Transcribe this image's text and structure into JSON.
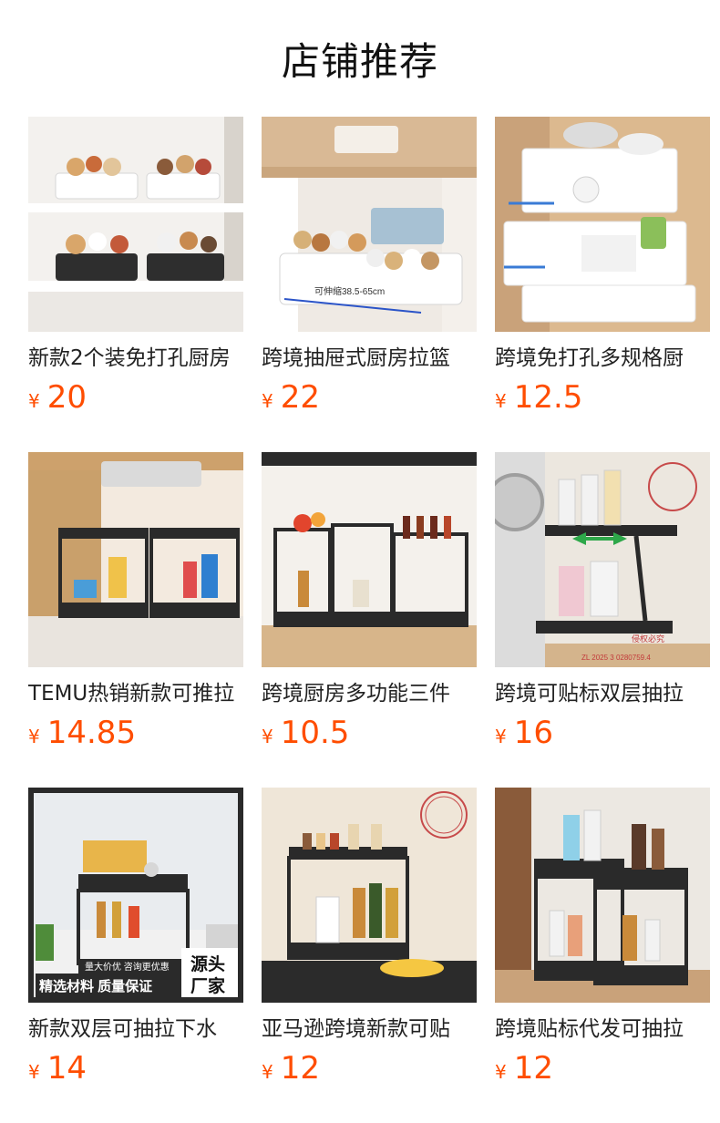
{
  "header": {
    "title": "店铺推荐"
  },
  "colors": {
    "price": "#ff4d00",
    "title": "#222222"
  },
  "products": [
    {
      "title": "新款2个装免打孔厨房",
      "currency": "¥",
      "price": "20",
      "icon": "under-sink-white-trays-image"
    },
    {
      "title": "跨境抽屉式厨房拉篮",
      "currency": "¥",
      "price": "22",
      "icon": "white-pullout-tray-image"
    },
    {
      "title": "跨境免打孔多规格厨",
      "currency": "¥",
      "price": "12.5",
      "icon": "white-sliding-drawers-image"
    },
    {
      "title": "TEMU热销新款可推拉",
      "currency": "¥",
      "price": "14.85",
      "icon": "black-two-tier-racks-image"
    },
    {
      "title": "跨境厨房多功能三件",
      "currency": "¥",
      "price": "10.5",
      "icon": "black-three-piece-racks-image"
    },
    {
      "title": "跨境可贴标双层抽拉",
      "currency": "¥",
      "price": "16",
      "icon": "black-sliding-rack-laundry-image",
      "watermark": "侵权必究",
      "stamp_code": "ZL 2025 3 0280759.4"
    },
    {
      "title": "新款双层可抽拉下水",
      "currency": "¥",
      "price": "14",
      "icon": "black-rack-promo-image",
      "promo_small": "量大价优 咨询更优惠",
      "promo_left": "精选材料 质量保证",
      "promo_right_1": "源头",
      "promo_right_2": "厂家"
    },
    {
      "title": "亚马逊跨境新款可贴",
      "currency": "¥",
      "price": "12",
      "icon": "black-spice-rack-image"
    },
    {
      "title": "跨境贴标代发可抽拉",
      "currency": "¥",
      "price": "12",
      "icon": "black-bathroom-rack-image"
    }
  ]
}
